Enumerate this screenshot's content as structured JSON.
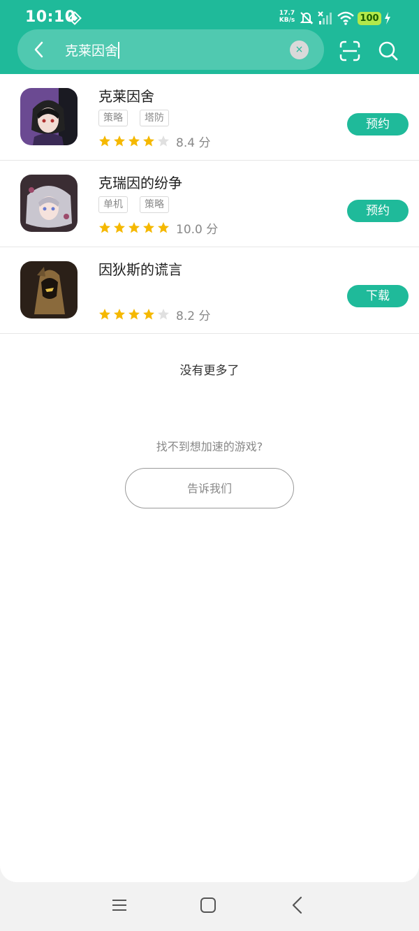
{
  "status_bar": {
    "time": "10:10",
    "net_speed_value": "17.7",
    "net_speed_unit": "KB/s",
    "battery": "100",
    "icons": [
      "vpn-icon",
      "mute-icon",
      "signal-icon",
      "wifi-icon",
      "charging-icon"
    ]
  },
  "header": {
    "search_value": "克莱因舍",
    "clear_glyph": "×",
    "icons": [
      "back-icon",
      "scan-icon",
      "search-icon"
    ]
  },
  "results": [
    {
      "name": "克莱因舍",
      "tags": [
        "策略",
        "塔防"
      ],
      "rating_stars": 4,
      "score": "8.4 分",
      "action": "预约"
    },
    {
      "name": "克瑞因的纷争",
      "tags": [
        "单机",
        "策略"
      ],
      "rating_stars": 5,
      "score": "10.0 分",
      "action": "预约"
    },
    {
      "name": "因狄斯的谎言",
      "tags": [],
      "rating_stars": 4,
      "score": "8.2 分",
      "action": "下载"
    }
  ],
  "footer": {
    "no_more": "没有更多了",
    "cant_find": "找不到想加速的游戏?",
    "tell_us": "告诉我们"
  },
  "colors": {
    "accent": "#1fba9a",
    "star_on": "#f5b800",
    "star_off": "#e0e0e0"
  }
}
